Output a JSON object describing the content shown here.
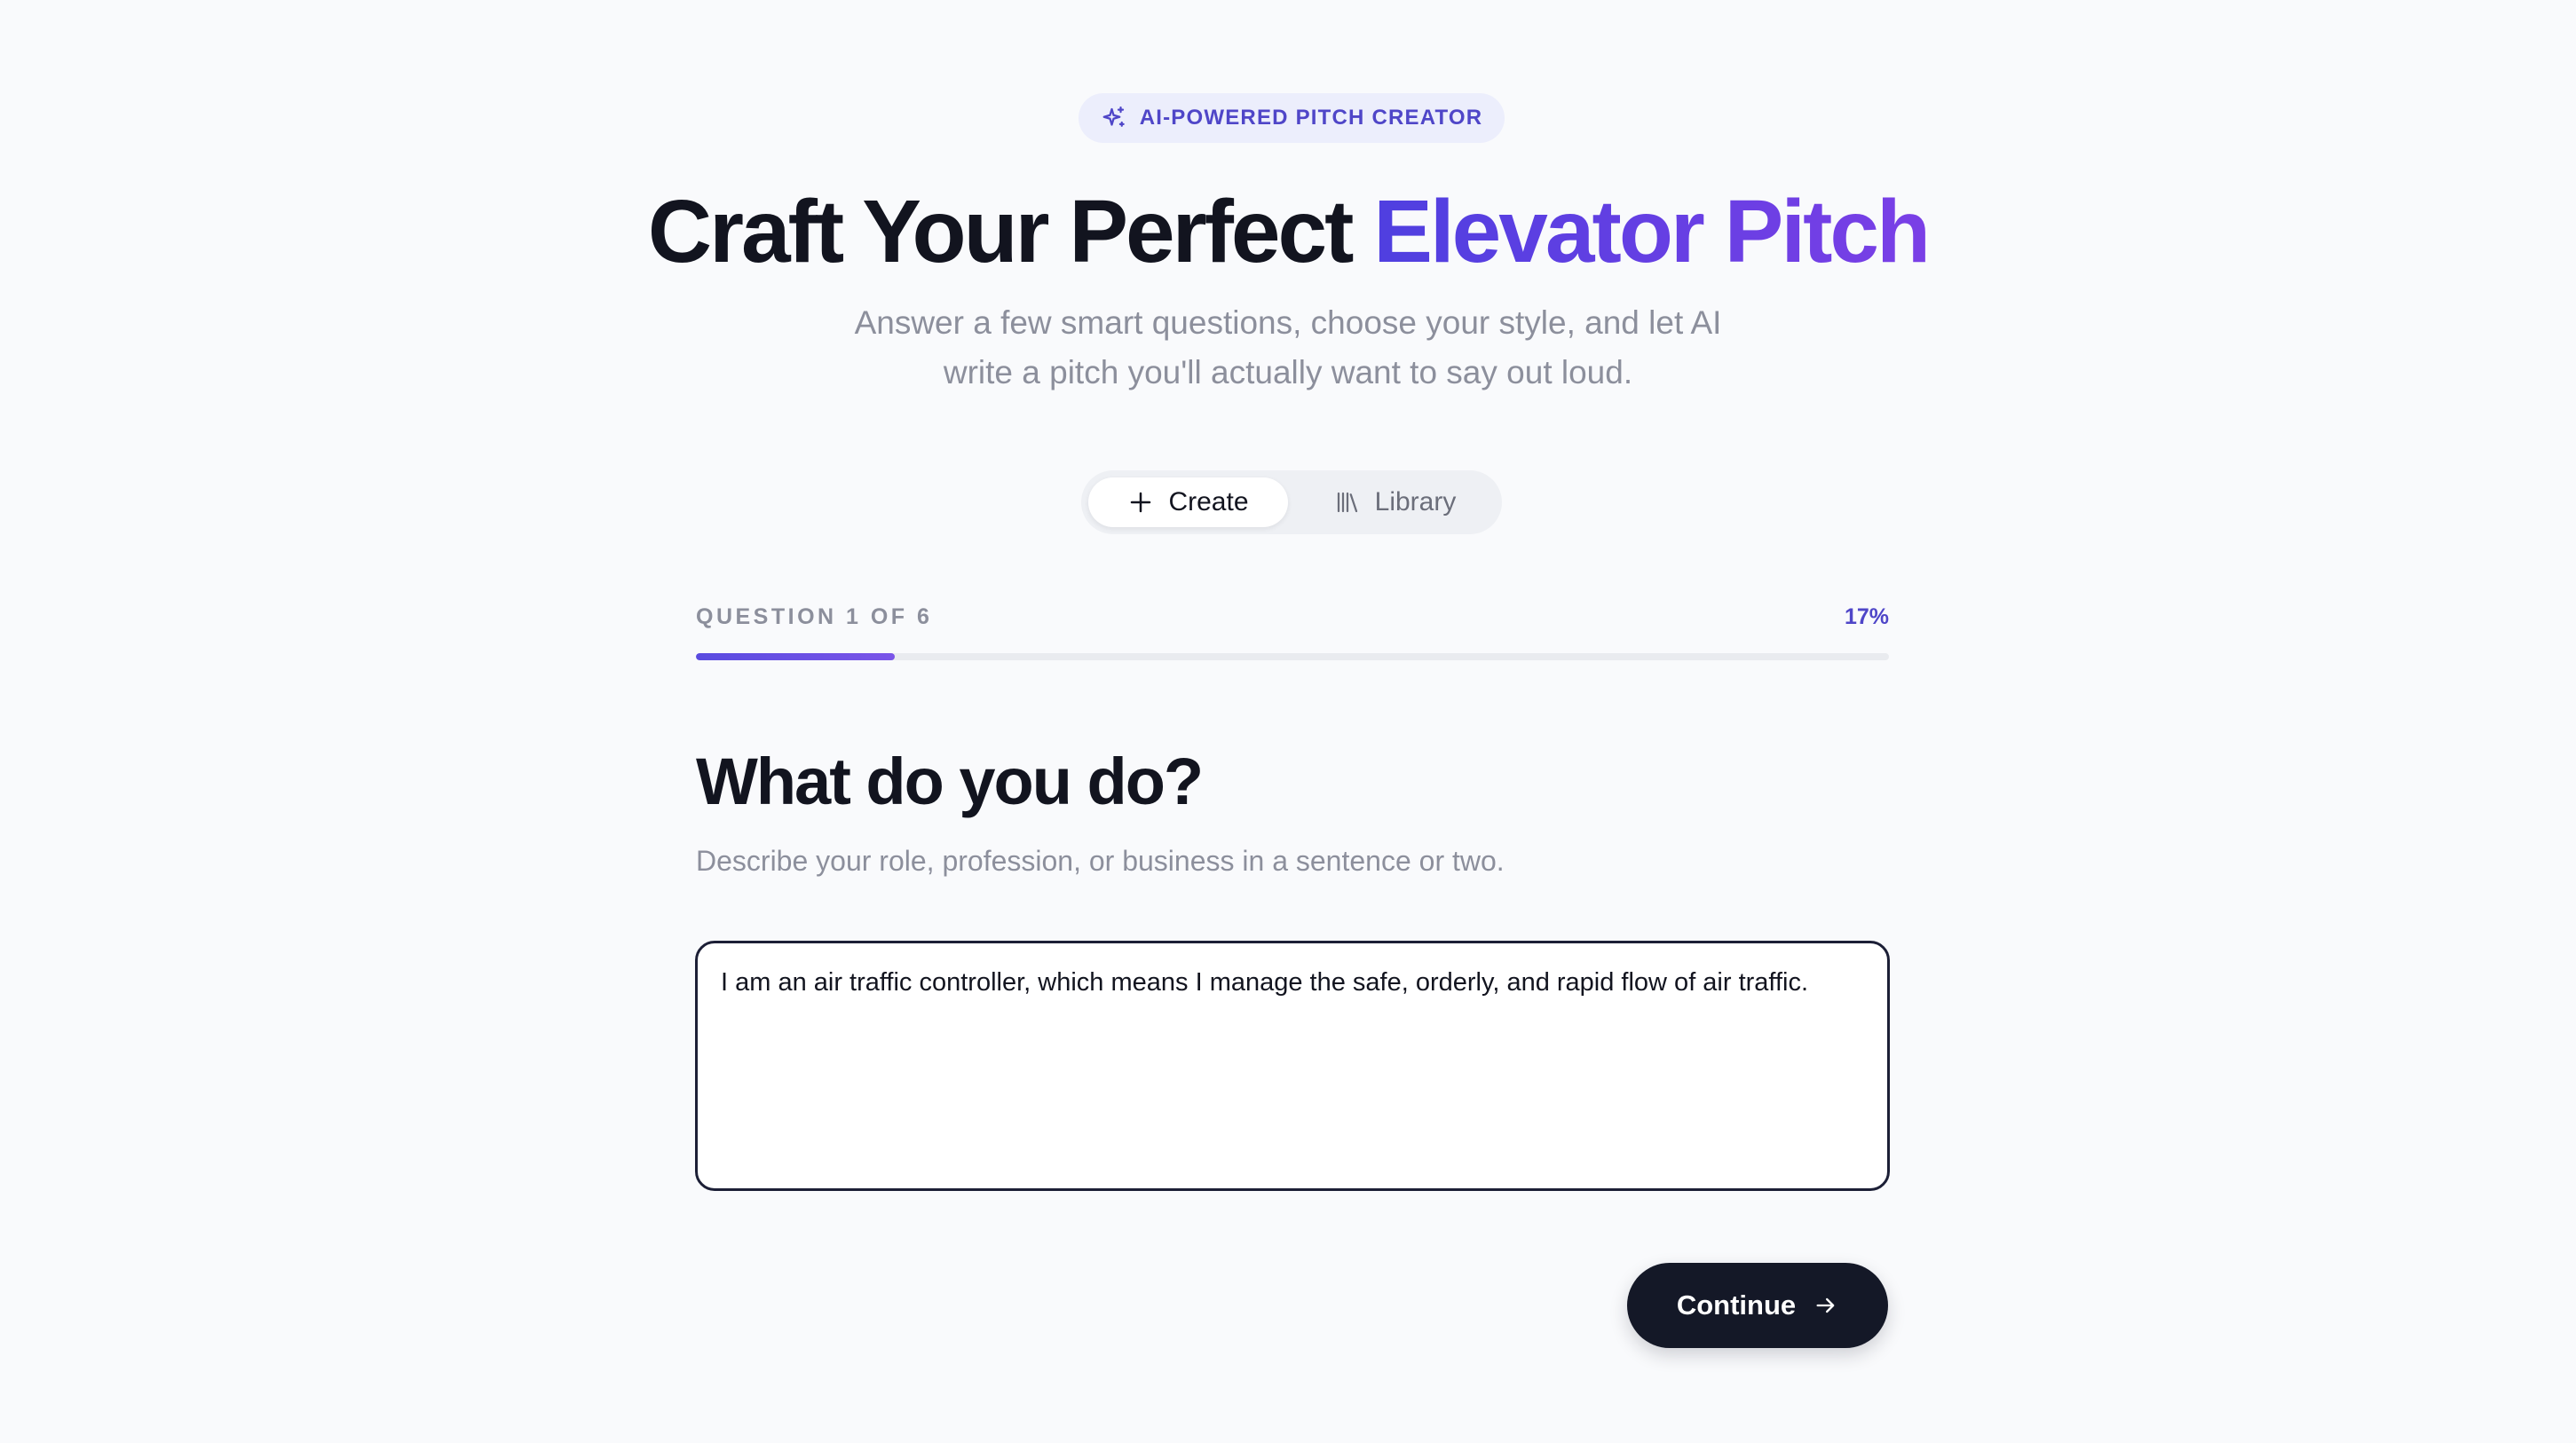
{
  "badge": {
    "icon": "sparkles-icon",
    "label": "AI-POWERED PITCH CREATOR"
  },
  "hero": {
    "title_main": "Craft Your Perfect ",
    "title_accent": "Elevator Pitch",
    "subtitle": "Answer a few smart questions, choose your style, and let AI write a pitch you'll actually want to say out loud."
  },
  "tabs": [
    {
      "label": "Create",
      "icon": "plus-icon",
      "active": true
    },
    {
      "label": "Library",
      "icon": "library-icon",
      "active": false
    }
  ],
  "progress": {
    "counter": "QUESTION 1 OF 6",
    "percent_label": "17%",
    "fraction": 0.167
  },
  "question": {
    "title": "What do you do?",
    "description": "Describe your role, profession, or business in a sentence or two.",
    "answer": "I am an air traffic controller, which means I manage the safe, orderly, and rapid flow of air traffic."
  },
  "actions": {
    "continue_label": "Continue",
    "continue_icon": "arrow-right-icon"
  },
  "colors": {
    "accent": "#4f46c8",
    "accent_gradient_start": "#4f3fe0",
    "accent_gradient_end": "#7a3fe6",
    "button_dark": "#141827",
    "background": "#f9fafc"
  }
}
